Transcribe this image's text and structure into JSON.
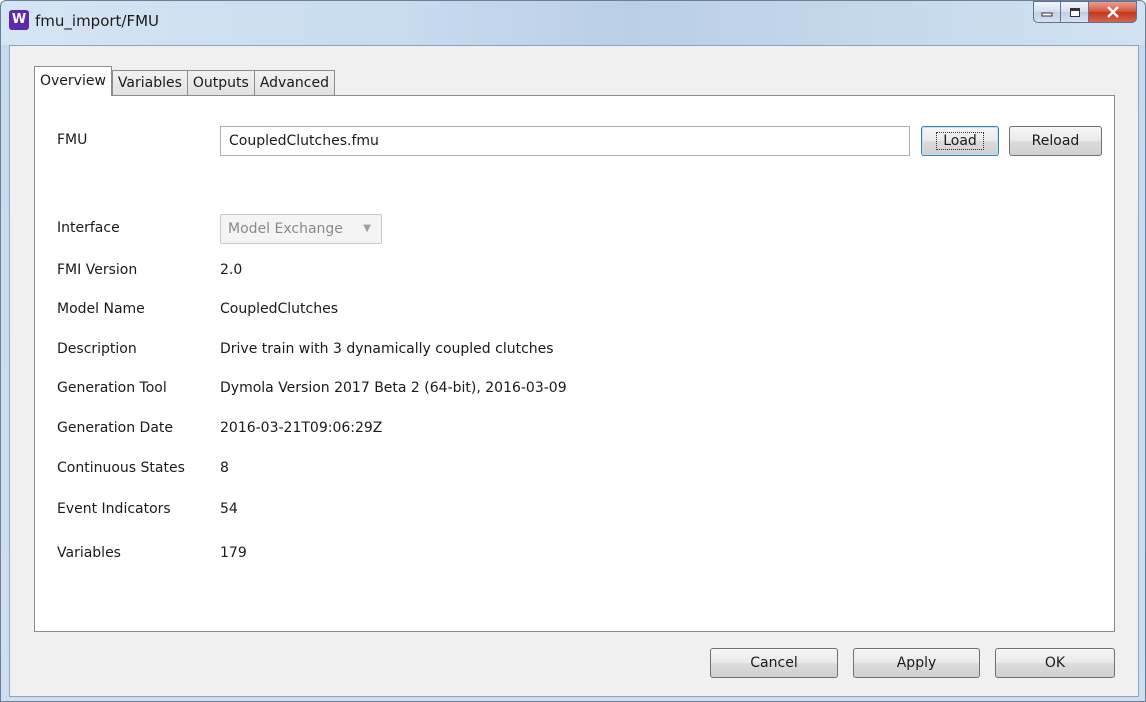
{
  "window": {
    "title": "fmu_import/FMU",
    "app_icon": "wave-icon"
  },
  "tabs": [
    {
      "label": "Overview",
      "active": true
    },
    {
      "label": "Variables",
      "active": false
    },
    {
      "label": "Outputs",
      "active": false
    },
    {
      "label": "Advanced",
      "active": false
    }
  ],
  "fmu": {
    "label": "FMU",
    "value": "CoupledClutches.fmu",
    "load_label": "Load",
    "reload_label": "Reload"
  },
  "interface": {
    "label": "Interface",
    "selected": "Model Exchange"
  },
  "fields": [
    {
      "label": "FMI Version",
      "value": "2.0"
    },
    {
      "label": "Model Name",
      "value": "CoupledClutches"
    },
    {
      "label": "Description",
      "value": "Drive train with 3 dynamically coupled clutches"
    },
    {
      "label": "Generation Tool",
      "value": "Dymola Version 2017 Beta 2 (64-bit), 2016-03-09"
    },
    {
      "label": "Generation Date",
      "value": "2016-03-21T09:06:29Z"
    },
    {
      "label": "Continuous States",
      "value": "8"
    },
    {
      "label": "Event Indicators",
      "value": "54"
    },
    {
      "label": "Variables",
      "value": "179"
    }
  ],
  "footer": {
    "cancel_label": "Cancel",
    "apply_label": "Apply",
    "ok_label": "OK"
  }
}
